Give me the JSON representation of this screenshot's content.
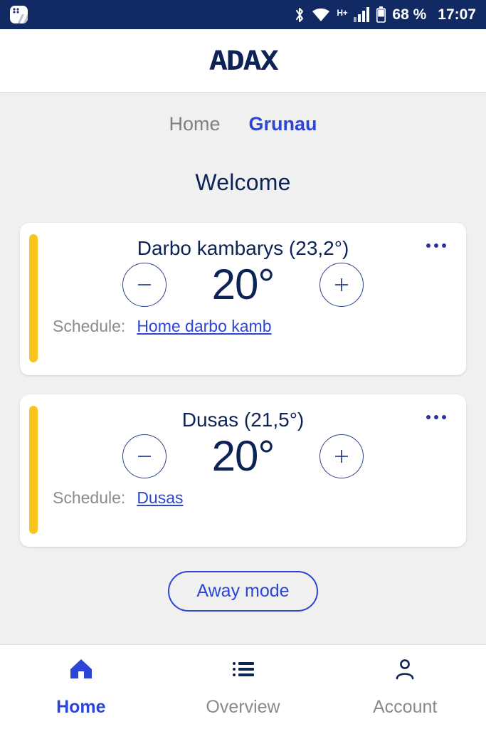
{
  "statusbar": {
    "notification_icon": "app-notification-icon",
    "bluetooth_icon": "bluetooth-icon",
    "wifi_icon": "wifi-icon",
    "network_type": "H+",
    "signal_icon": "cellular-signal-icon",
    "battery_icon": "battery-icon",
    "battery_percent": "68 %",
    "time": "17:07"
  },
  "header": {
    "logo": "ADAX"
  },
  "tabs": [
    {
      "label": "Home",
      "active": false
    },
    {
      "label": "Grunau",
      "active": true
    }
  ],
  "page_title": "Welcome",
  "rooms": [
    {
      "title": "Darbo kambarys (23,2°)",
      "name": "Darbo kambarys",
      "current_temp": "23,2°",
      "setpoint": "20°",
      "decrease_label": "−",
      "increase_label": "+",
      "schedule_label": "Schedule:",
      "schedule_value": "Home darbo kamb",
      "menu_icon": "more-options-icon",
      "accent_color": "#f8c51c"
    },
    {
      "title": "Dusas (21,5°)",
      "name": "Dusas",
      "current_temp": "21,5°",
      "setpoint": "20°",
      "decrease_label": "−",
      "increase_label": "+",
      "schedule_label": "Schedule:",
      "schedule_value": "Dusas",
      "menu_icon": "more-options-icon",
      "accent_color": "#f8c51c"
    }
  ],
  "away_button": "Away mode",
  "bottomnav": [
    {
      "label": "Home",
      "icon": "home-icon",
      "active": true
    },
    {
      "label": "Overview",
      "icon": "list-icon",
      "active": false
    },
    {
      "label": "Account",
      "icon": "person-icon",
      "active": false
    }
  ],
  "colors": {
    "navy": "#0d2355",
    "status_bar": "#112a63",
    "accent_blue": "#2c45d6",
    "accent_yellow": "#f8c51c",
    "muted_gray": "#8a8a8a",
    "background": "#f0f0f0"
  }
}
